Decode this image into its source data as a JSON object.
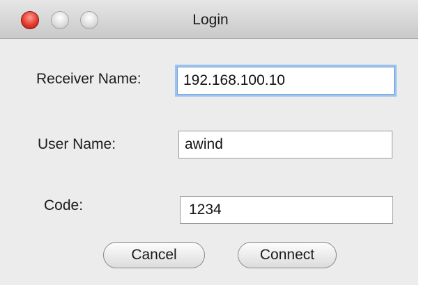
{
  "window": {
    "title": "Login"
  },
  "form": {
    "receiver_label": "Receiver Name:",
    "receiver_value": "192.168.100.10",
    "user_label": "User Name:",
    "user_value": "awind",
    "code_label": "Code:",
    "code_value": "1234"
  },
  "buttons": {
    "cancel_label": "Cancel",
    "connect_label": "Connect"
  },
  "icons": {
    "close": "close-icon",
    "minimize": "minimize-icon",
    "zoom": "zoom-icon"
  },
  "colors": {
    "close_button": "#e23c2e",
    "focus_ring": "#9cc3ef"
  }
}
